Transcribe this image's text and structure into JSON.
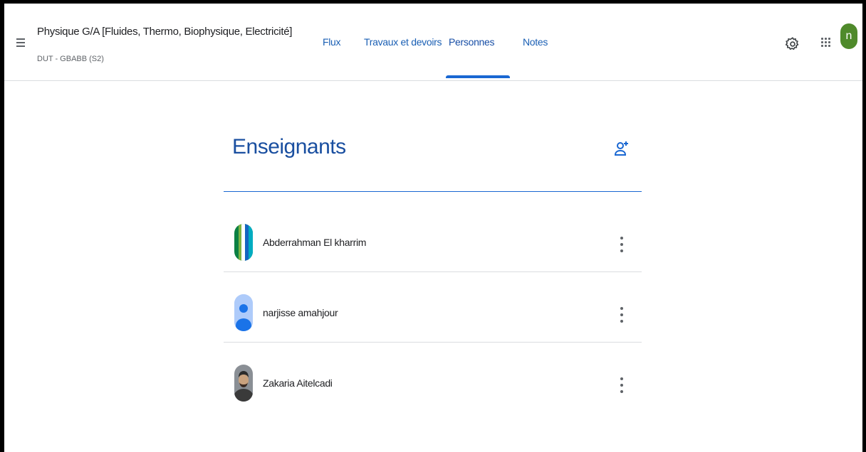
{
  "header": {
    "class_title": "Physique G/A [Fluides, Thermo, Biophysique, Electricité]",
    "class_subtitle": "DUT - GBABB (S2)",
    "tabs": [
      {
        "label": "Flux",
        "active": false
      },
      {
        "label": "Travaux et devoirs",
        "active": false
      },
      {
        "label": "Personnes",
        "active": true
      },
      {
        "label": "Notes",
        "active": false
      }
    ],
    "user_initial": "n",
    "icons": [
      "menu-icon",
      "gear-icon",
      "apps-grid-icon"
    ]
  },
  "teachers": {
    "title": "Enseignants",
    "add_icon": "add-person-icon",
    "people": [
      {
        "name": "Abderrahman El kharrim",
        "avatar": "striped-green-blue"
      },
      {
        "name": "narjisse amahjour",
        "avatar": "default-person"
      },
      {
        "name": "Zakaria Aitelcadi",
        "avatar": "photo"
      }
    ]
  },
  "colors": {
    "accent": "#1967d2",
    "tab_text": "#1a5fb4",
    "user_avatar": "#4f8a2b",
    "divider": "#dadce0"
  }
}
